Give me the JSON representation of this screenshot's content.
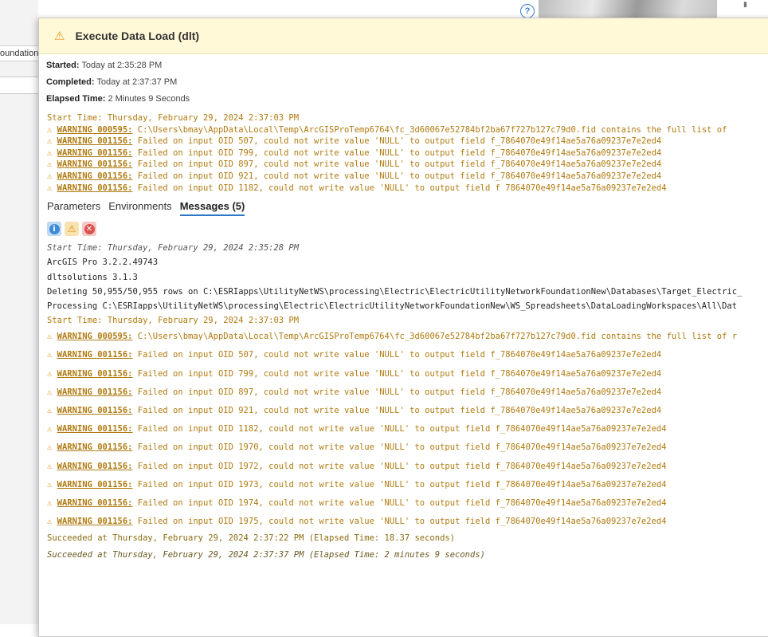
{
  "background": {
    "tab_label": "oundation"
  },
  "popup": {
    "title": "Execute Data Load (dlt)",
    "started_label": "Started:",
    "started_value": "Today at 2:35:28 PM",
    "completed_label": "Completed:",
    "completed_value": "Today at 2:37:37 PM",
    "elapsed_label": "Elapsed Time:",
    "elapsed_value": "2 Minutes 9 Seconds",
    "summary": [
      {
        "type": "plain",
        "text": "Start Time: Thursday, February 29, 2024 2:37:03 PM"
      },
      {
        "type": "warning",
        "code": "WARNING 000595:",
        "text": "C:\\Users\\bmay\\AppData\\Local\\Temp\\ArcGISProTemp6764\\fc_3d60067e52784bf2ba67f727b127c79d0.fid contains the full list of"
      },
      {
        "type": "warning",
        "code": "WARNING 001156:",
        "text": "Failed on input OID 507, could not write value 'NULL' to output field f_7864070e49f14ae5a76a09237e7e2ed4"
      },
      {
        "type": "warning",
        "code": "WARNING 001156:",
        "text": "Failed on input OID 799, could not write value 'NULL' to output field f_7864070e49f14ae5a76a09237e7e2ed4"
      },
      {
        "type": "warning",
        "code": "WARNING 001156:",
        "text": "Failed on input OID 897, could not write value 'NULL' to output field f_7864070e49f14ae5a76a09237e7e2ed4"
      },
      {
        "type": "warning",
        "code": "WARNING 001156:",
        "text": "Failed on input OID 921, could not write value 'NULL' to output field f_7864070e49f14ae5a76a09237e7e2ed4"
      },
      {
        "type": "warning",
        "code": "WARNING 001156:",
        "text": "Failed on input OID 1182, could not write value 'NULL' to output field f 7864070e49f14ae5a76a09237e7e2ed4"
      }
    ],
    "tabs": [
      {
        "label": "Parameters",
        "active": false
      },
      {
        "label": "Environments",
        "active": false
      },
      {
        "label": "Messages (5)",
        "active": true
      }
    ],
    "messages": [
      {
        "type": "italic",
        "text": "Start Time: Thursday, February 29, 2024 2:35:28 PM"
      },
      {
        "type": "info",
        "text": "ArcGIS Pro 3.2.2.49743"
      },
      {
        "type": "info",
        "text": "dltsolutions 3.1.3"
      },
      {
        "type": "info",
        "text": "Deleting 50,955/50,955 rows on C:\\ESRIapps\\UtilityNetWS\\processing\\Electric\\ElectricUtilityNetworkFoundationNew\\Databases\\Target_Electric_"
      },
      {
        "type": "info",
        "text": "Processing C:\\ESRIapps\\UtilityNetWS\\processing\\Electric\\ElectricUtilityNetworkFoundationNew\\WS_Spreadsheets\\DataLoadingWorkspaces\\All\\Dat"
      },
      {
        "type": "warnplain",
        "text": "Start Time: Thursday, February 29, 2024 2:37:03 PM"
      },
      {
        "type": "warning",
        "code": "WARNING 000595:",
        "text": "C:\\Users\\bmay\\AppData\\Local\\Temp\\ArcGISProTemp6764\\fc_3d60067e52784bf2ba67f727b127c79d0.fid contains the full list of r"
      },
      {
        "type": "warning",
        "code": "WARNING 001156:",
        "text": "Failed on input OID 507, could not write value 'NULL' to output field f_7864070e49f14ae5a76a09237e7e2ed4"
      },
      {
        "type": "warning",
        "code": "WARNING 001156:",
        "text": "Failed on input OID 799, could not write value 'NULL' to output field f_7864070e49f14ae5a76a09237e7e2ed4"
      },
      {
        "type": "warning",
        "code": "WARNING 001156:",
        "text": "Failed on input OID 897, could not write value 'NULL' to output field f_7864070e49f14ae5a76a09237e7e2ed4"
      },
      {
        "type": "warning",
        "code": "WARNING 001156:",
        "text": "Failed on input OID 921, could not write value 'NULL' to output field f_7864070e49f14ae5a76a09237e7e2ed4"
      },
      {
        "type": "warning",
        "code": "WARNING 001156:",
        "text": "Failed on input OID 1182, could not write value 'NULL' to output field f_7864070e49f14ae5a76a09237e7e2ed4"
      },
      {
        "type": "warning",
        "code": "WARNING 001156:",
        "text": "Failed on input OID 1970, could not write value 'NULL' to output field f_7864070e49f14ae5a76a09237e7e2ed4"
      },
      {
        "type": "warning",
        "code": "WARNING 001156:",
        "text": "Failed on input OID 1972, could not write value 'NULL' to output field f_7864070e49f14ae5a76a09237e7e2ed4"
      },
      {
        "type": "warning",
        "code": "WARNING 001156:",
        "text": "Failed on input OID 1973, could not write value 'NULL' to output field f_7864070e49f14ae5a76a09237e7e2ed4"
      },
      {
        "type": "warning",
        "code": "WARNING 001156:",
        "text": "Failed on input OID 1974, could not write value 'NULL' to output field f_7864070e49f14ae5a76a09237e7e2ed4"
      },
      {
        "type": "warning",
        "code": "WARNING 001156:",
        "text": "Failed on input OID 1975, could not write value 'NULL' to output field f_7864070e49f14ae5a76a09237e7e2ed4"
      },
      {
        "type": "success",
        "text": "Succeeded at Thursday, February 29, 2024 2:37:22 PM (Elapsed Time: 18.37 seconds)"
      },
      {
        "type": "success-i",
        "text": "Succeeded at Thursday, February 29, 2024 2:37:37 PM (Elapsed Time: 2 minutes 9 seconds)"
      }
    ]
  },
  "icons": {
    "warning": "warning-icon",
    "info_filter": "info-filter-icon",
    "warning_filter": "warning-filter-icon",
    "error_filter": "error-filter-icon",
    "help": "help-icon"
  },
  "colors": {
    "header_bg": "#fff9d8",
    "warning_text": "#b07a10",
    "warning_icon": "#e79a2b",
    "active_tab_underline": "#2d77c3"
  }
}
